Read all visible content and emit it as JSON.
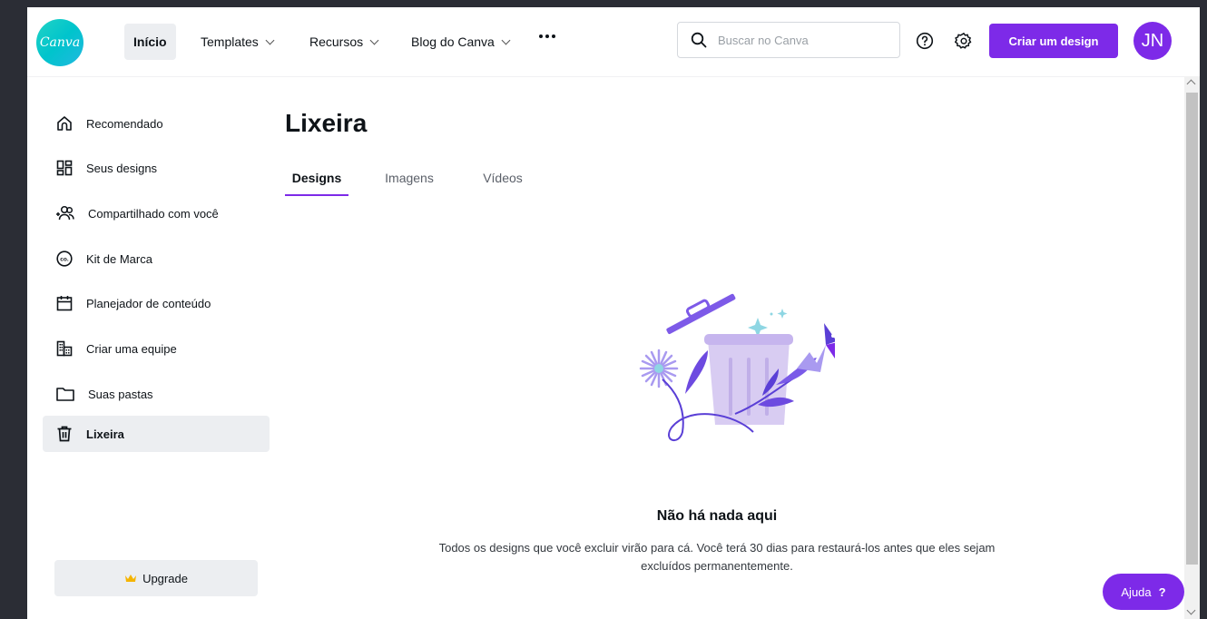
{
  "header": {
    "logo_text": "Canva",
    "nav": [
      {
        "label": "Início"
      },
      {
        "label": "Templates"
      },
      {
        "label": "Recursos"
      },
      {
        "label": "Blog do Canva"
      }
    ],
    "search_placeholder": "Buscar no Canva",
    "create_button": "Criar um design",
    "avatar_initials": "JN"
  },
  "sidebar": {
    "items": [
      {
        "label": "Recomendado",
        "icon": "home-icon"
      },
      {
        "label": "Seus designs",
        "icon": "grid-icon"
      },
      {
        "label": "Compartilhado com você",
        "icon": "shared-users-icon"
      },
      {
        "label": "Kit de Marca",
        "icon": "brand-kit-icon"
      },
      {
        "label": "Planejador de conteúdo",
        "icon": "calendar-icon"
      },
      {
        "label": "Criar uma equipe",
        "icon": "team-building-icon"
      },
      {
        "label": "Suas pastas",
        "icon": "folder-icon"
      },
      {
        "label": "Lixeira",
        "icon": "trash-icon",
        "active": true
      }
    ],
    "upgrade_label": "Upgrade"
  },
  "main": {
    "title": "Lixeira",
    "tabs": [
      {
        "label": "Designs",
        "active": true
      },
      {
        "label": "Imagens"
      },
      {
        "label": "Vídeos"
      }
    ],
    "empty_title": "Não há nada aqui",
    "empty_description": "Todos os designs que você excluir virão para cá. Você terá 30 dias para restaurá-los antes que eles sejam excluídos permanentemente."
  },
  "help_button": "Ajuda",
  "help_mark": "?",
  "colors": {
    "accent": "#7d2ae8",
    "background_frame": "#2b2d35",
    "logo_teal": "#00c4cc"
  }
}
